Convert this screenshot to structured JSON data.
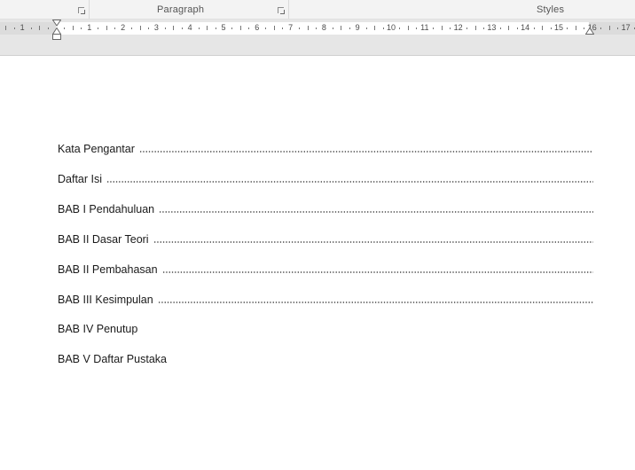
{
  "ribbon": {
    "groups": [
      {
        "label": ""
      },
      {
        "label": "Paragraph"
      },
      {
        "label": "Styles"
      }
    ]
  },
  "ruler": {
    "numbers_left": [
      "1"
    ],
    "numbers_right": [
      "1",
      "2",
      "3",
      "4",
      "5",
      "6",
      "7",
      "8",
      "9",
      "10",
      "11",
      "12",
      "13",
      "14",
      "15",
      "16",
      "17"
    ]
  },
  "document": {
    "toc_entries": [
      {
        "text": "Kata Pengantar",
        "leader": true
      },
      {
        "text": "Daftar Isi",
        "leader": true
      },
      {
        "text": "BAB I Pendahuluan",
        "leader": true
      },
      {
        "text": "BAB II Dasar Teori",
        "leader": true
      },
      {
        "text": "BAB II Pembahasan",
        "leader": true
      },
      {
        "text": "BAB III Kesimpulan",
        "leader": true
      },
      {
        "text": "BAB IV Penutup",
        "leader": false
      },
      {
        "text": "BAB V Daftar Pustaka",
        "leader": false
      }
    ]
  }
}
